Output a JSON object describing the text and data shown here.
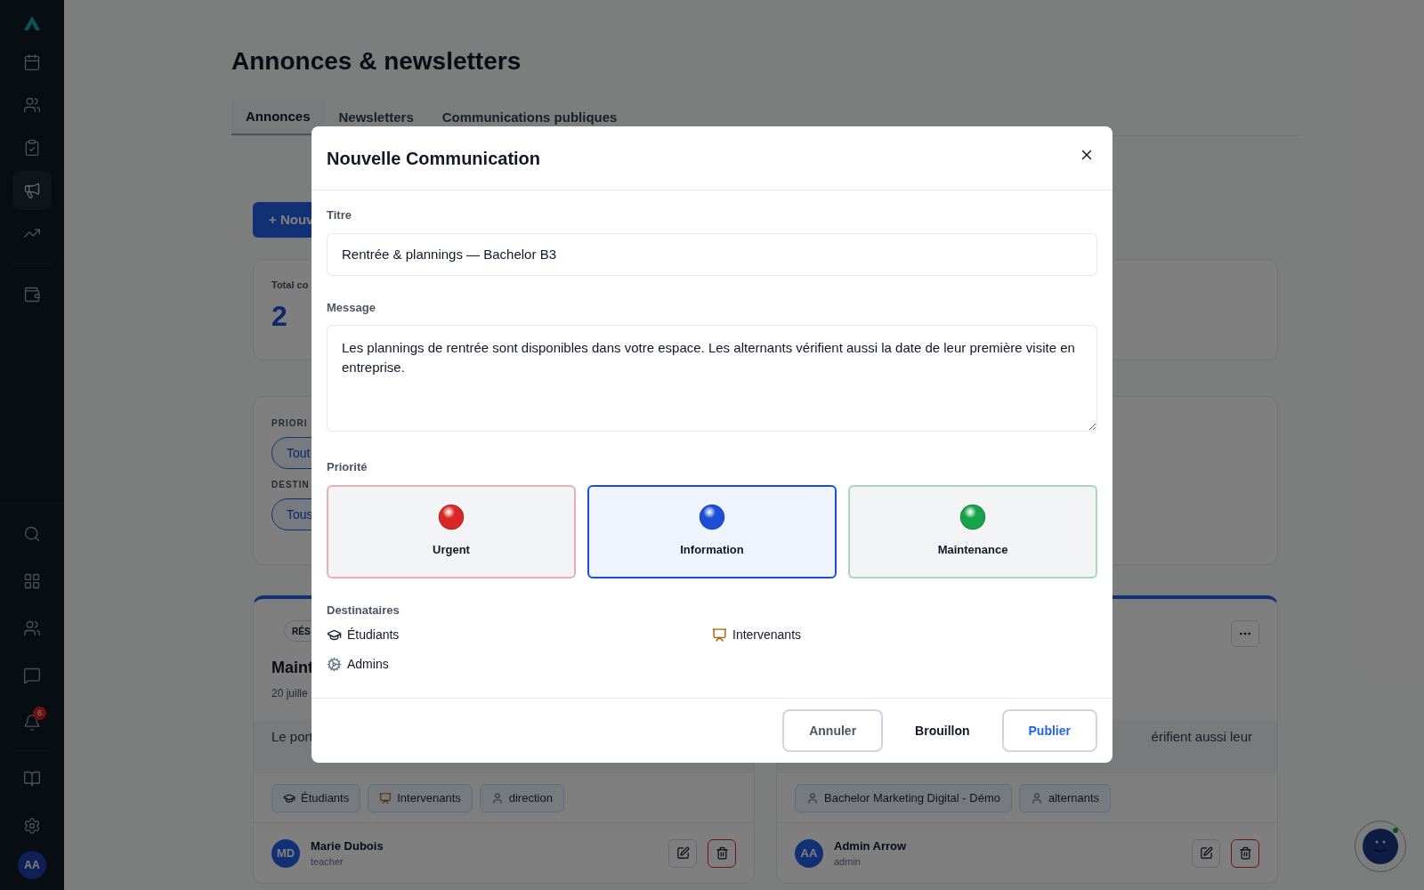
{
  "sidebar": {
    "top_items": [
      {
        "kind": "calendar",
        "selected": false
      },
      {
        "kind": "users",
        "selected": false
      },
      {
        "kind": "clipboard",
        "selected": false
      },
      {
        "kind": "megaphone",
        "selected": true
      },
      {
        "kind": "trend",
        "selected": false
      }
    ],
    "extra_items": [
      {
        "kind": "wallet",
        "selected": false
      }
    ],
    "bottom_items": [
      {
        "kind": "search"
      },
      {
        "kind": "grid"
      },
      {
        "kind": "users"
      },
      {
        "kind": "message"
      },
      {
        "kind": "bell",
        "badge": "6"
      },
      {
        "kind": "book"
      },
      {
        "kind": "settings"
      }
    ],
    "avatar": "AA"
  },
  "page": {
    "title": "Annonces & newsletters",
    "tabs": [
      {
        "label": "Annonces",
        "selected": true
      },
      {
        "label": "Newsletters",
        "selected": false
      },
      {
        "label": "Communications publiques",
        "selected": false
      }
    ],
    "new_button": "+ Nouv",
    "stats": {
      "label": "Total co",
      "value": "2"
    },
    "filters": [
      {
        "label": "PRIORI",
        "chip": "Tout"
      },
      {
        "label": "DESTIN",
        "chip": "Tous"
      }
    ],
    "cards": [
      {
        "badge": "RÉS",
        "title": "Maint",
        "date": "20 juille",
        "body": "Le port",
        "tags": [
          {
            "kind": "student",
            "label": "Étudiants"
          },
          {
            "kind": "teacher",
            "label": "Intervenants"
          },
          {
            "kind": "person",
            "label": "direction"
          }
        ],
        "author": {
          "initials": "MD",
          "name": "Marie Dubois",
          "role": "teacher"
        }
      },
      {
        "body": "érifient aussi leur",
        "menu": true,
        "tags": [
          {
            "kind": "person",
            "label": "Bachelor Marketing Digital - Démo"
          },
          {
            "kind": "person",
            "label": "alternants"
          }
        ],
        "author": {
          "initials": "AA",
          "name": "Admin Arrow",
          "role": "admin"
        }
      }
    ]
  },
  "modal": {
    "title": "Nouvelle Communication",
    "title_label": "Titre",
    "title_value": "Rentrée & plannings — Bachelor B3",
    "message_label": "Message",
    "message_value": "Les plannings de rentrée sont disponibles dans votre espace. Les alternants vérifient aussi la date de leur première visite en entreprise.",
    "priority_label": "Priorité",
    "priorities": [
      {
        "label": "Urgent",
        "color": "#dc2626",
        "selected": false
      },
      {
        "label": "Information",
        "color": "#1d4ed8",
        "selected": true
      },
      {
        "label": "Maintenance",
        "color": "#16a34a",
        "selected": false
      }
    ],
    "recipients_label": "Destinataires",
    "recipients": [
      {
        "kind": "student",
        "label": "Étudiants"
      },
      {
        "kind": "teacher",
        "label": "Intervenants"
      },
      {
        "kind": "admin",
        "label": "Admins"
      }
    ],
    "buttons": [
      {
        "kind": "outline",
        "label": "Annuler"
      },
      {
        "kind": "plain",
        "label": "Brouillon"
      },
      {
        "kind": "primary",
        "label": "Publier"
      }
    ]
  }
}
